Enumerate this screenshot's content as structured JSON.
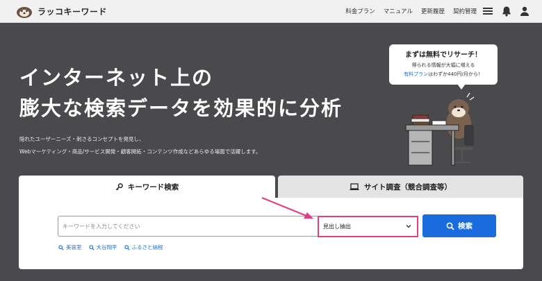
{
  "header": {
    "logo_text": "ラッコキーワード",
    "nav": [
      "料金プラン",
      "マニュアル",
      "更新履歴",
      "契約管理"
    ],
    "icons": [
      "menu-icon",
      "bell-icon",
      "user-icon"
    ]
  },
  "hero": {
    "title_line1": "インターネット上の",
    "title_line2": "膨大な検索データを効果的に分析",
    "desc_line1": "隠れたユーザーニーズ・刺さるコンセプトを発見し、",
    "desc_line2": "Webマーケティング・商品/サービス開発・顧客開拓・コンテンツ作成などあらゆる場面で活躍します。"
  },
  "bubble": {
    "title": "まずは無料でリサーチ！",
    "line1": "得られる情報が大幅に増える",
    "plan_link": "有料プラン",
    "line2_rest": "はわずか440円/月から！"
  },
  "tabs": [
    {
      "label": "キーワード検索",
      "icon": "key-icon",
      "active": true
    },
    {
      "label": "サイト調査（競合調査等）",
      "icon": "laptop-icon",
      "active": false
    }
  ],
  "search": {
    "placeholder": "キーワードを入力してください",
    "select_value": "見出し抽出",
    "button_label": "検索"
  },
  "suggestions": [
    "美容室",
    "大谷翔平",
    "ふるさと納税"
  ],
  "colors": {
    "accent_blue": "#1a6bdc",
    "highlight_pink": "#e43c87",
    "background_dark": "#4a4a4d"
  }
}
